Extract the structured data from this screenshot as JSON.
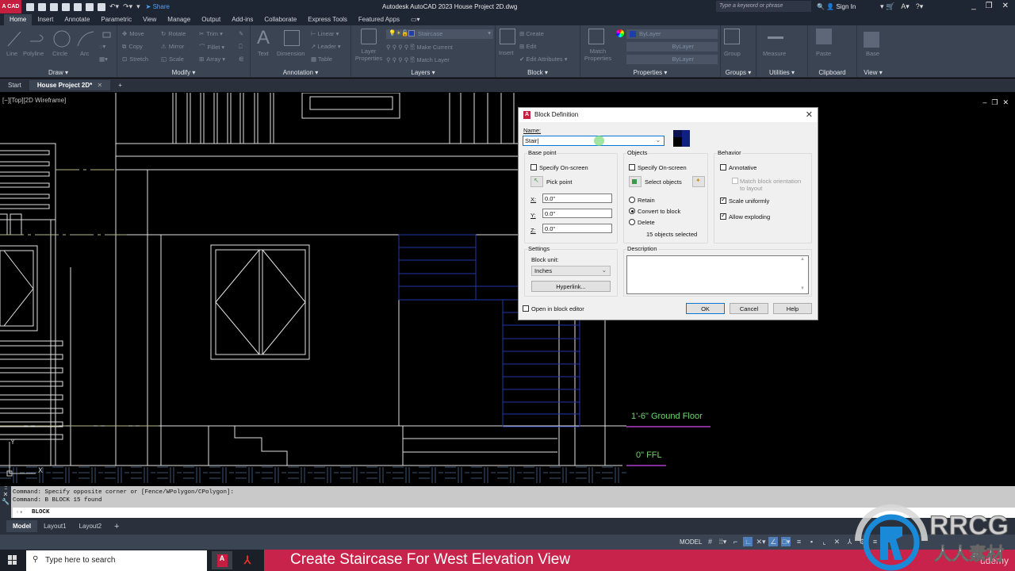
{
  "app": {
    "badge": "A CAD",
    "title": "Autodesk AutoCAD 2023    House Project 2D.dwg",
    "share_label": "Share",
    "search_placeholder": "Type a keyword or phrase",
    "sign_in": "Sign In"
  },
  "ribbon_tabs": [
    "Home",
    "Insert",
    "Annotate",
    "Parametric",
    "View",
    "Manage",
    "Output",
    "Add-ins",
    "Collaborate",
    "Express Tools",
    "Featured Apps"
  ],
  "ribbon": {
    "draw": {
      "label": "Draw ▾",
      "tools": [
        "Line",
        "Polyline",
        "Circle",
        "Arc"
      ]
    },
    "modify": {
      "label": "Modify ▾",
      "tools": [
        "Move",
        "Rotate",
        "Trim",
        "Copy",
        "Mirror",
        "Fillet",
        "Stretch",
        "Scale",
        "Array"
      ]
    },
    "annotation": {
      "label": "Annotation ▾",
      "tools": [
        "Text",
        "Dimension",
        "Linear",
        "Leader",
        "Table"
      ]
    },
    "layers": {
      "label": "Layers ▾",
      "layer_properties": "Layer Properties",
      "current_layer": "Staircase",
      "make_current": "Make Current",
      "match_layer": "Match Layer"
    },
    "block": {
      "label": "Block ▾",
      "insert": "Insert",
      "create": "Create",
      "edit": "Edit",
      "edit_attributes": "Edit Attributes"
    },
    "properties": {
      "label": "Properties ▾",
      "match": "Match Properties",
      "color": "ByLayer",
      "linetype": "ByLayer",
      "lineweight": "ByLayer"
    },
    "groups": {
      "label": "Groups ▾",
      "group": "Group"
    },
    "utilities": {
      "label": "Utilities ▾",
      "measure": "Measure"
    },
    "clipboard": {
      "label": "Clipboard",
      "paste": "Paste"
    },
    "view": {
      "label": "View ▾",
      "base": "Base"
    }
  },
  "doc_tabs": {
    "start": "Start",
    "active": "House Project 2D*",
    "add": "+"
  },
  "viewport": {
    "label": "[−][Top][2D Wireframe]",
    "level_labels": [
      {
        "text": "1'-6\" Ground Floor",
        "color": "#6fd36f"
      },
      {
        "text": "0\" FFL",
        "color": "#6fd36f"
      }
    ]
  },
  "dialog": {
    "title": "Block Definition",
    "name_label": "Name:",
    "name_value": "Stair",
    "base_point": {
      "legend": "Base point",
      "specify_on_screen": "Specify On-screen",
      "specify_checked": false,
      "pick_point": "Pick point",
      "x_label": "X:",
      "x": "0.0\"",
      "y_label": "Y:",
      "y": "0.0\"",
      "z_label": "Z:",
      "z": "0.0\""
    },
    "objects": {
      "legend": "Objects",
      "specify_on_screen": "Specify On-screen",
      "specify_checked": false,
      "select_objects": "Select objects",
      "retain": "Retain",
      "convert": "Convert to block",
      "delete": "Delete",
      "selected_option": "Convert to block",
      "count_text": "15 objects selected"
    },
    "behavior": {
      "legend": "Behavior",
      "annotative": "Annotative",
      "annotative_checked": false,
      "match_orientation": "Match block orientation to layout",
      "match_checked": false,
      "scale_uniformly": "Scale uniformly",
      "scale_checked": true,
      "allow_exploding": "Allow exploding",
      "explode_checked": true
    },
    "settings": {
      "legend": "Settings",
      "block_unit_label": "Block unit:",
      "block_unit": "Inches",
      "hyperlink": "Hyperlink..."
    },
    "description": {
      "legend": "Description",
      "value": ""
    },
    "open_in_editor": "Open in block editor",
    "open_checked": false,
    "ok": "OK",
    "cancel": "Cancel",
    "help": "Help"
  },
  "command": {
    "history": [
      "Command: Specify opposite corner or [Fence/WPolygon/CPolygon]:",
      "Command: B BLOCK 15 found"
    ],
    "input": "BLOCK"
  },
  "layout_tabs": [
    "Model",
    "Layout1",
    "Layout2",
    "+"
  ],
  "status": {
    "model": "MODEL"
  },
  "taskbar": {
    "search_placeholder": "Type here to search",
    "banner": "Create Staircase For West Elevation View",
    "udemy": "ûdemy"
  },
  "watermark": {
    "line1": "RRCG",
    "line2": "人人素材"
  },
  "colors": {
    "app_red": "#c41f3e",
    "ribbon_bg": "#3b4453",
    "dark_bg": "#1f2633",
    "banner": "#c8234a",
    "stair_blue": "#1e2e8a",
    "cad_white": "#e8e8e8",
    "level_green": "#6fd36f",
    "level_magenta": "#b03cc8"
  }
}
